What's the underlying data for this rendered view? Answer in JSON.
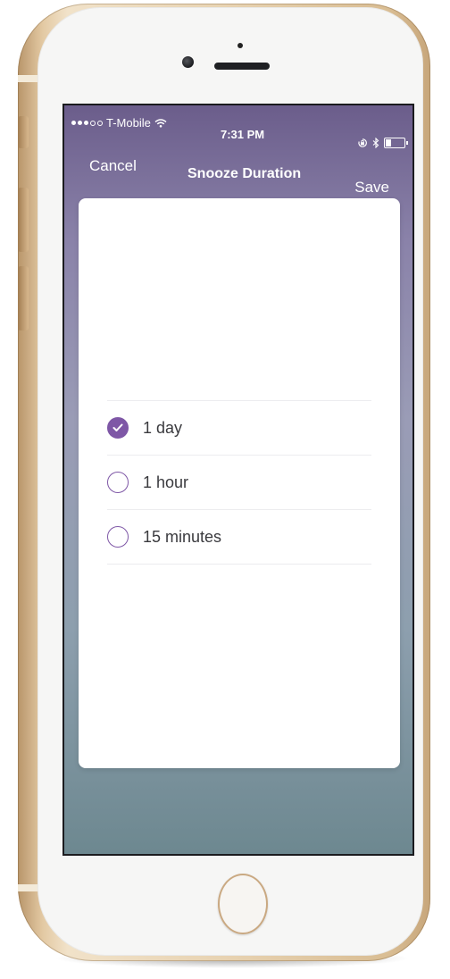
{
  "status_bar": {
    "carrier": "T-Mobile",
    "time": "7:31 PM",
    "signal_bars_filled": 3,
    "signal_bars_total": 5,
    "icons": [
      "wifi-icon",
      "rotation-lock-icon",
      "bluetooth-icon",
      "battery-icon"
    ],
    "battery_level": 0.3
  },
  "nav": {
    "cancel_label": "Cancel",
    "title": "Snooze Duration",
    "save_label": "Save"
  },
  "options": [
    {
      "label": "1 day",
      "selected": true
    },
    {
      "label": "1 hour",
      "selected": false
    },
    {
      "label": "15 minutes",
      "selected": false
    }
  ],
  "colors": {
    "accent": "#7e57a6",
    "header_top": "#6b5d8b",
    "background_bottom": "#6d8890",
    "phone_gold": "#e3c9a3"
  }
}
